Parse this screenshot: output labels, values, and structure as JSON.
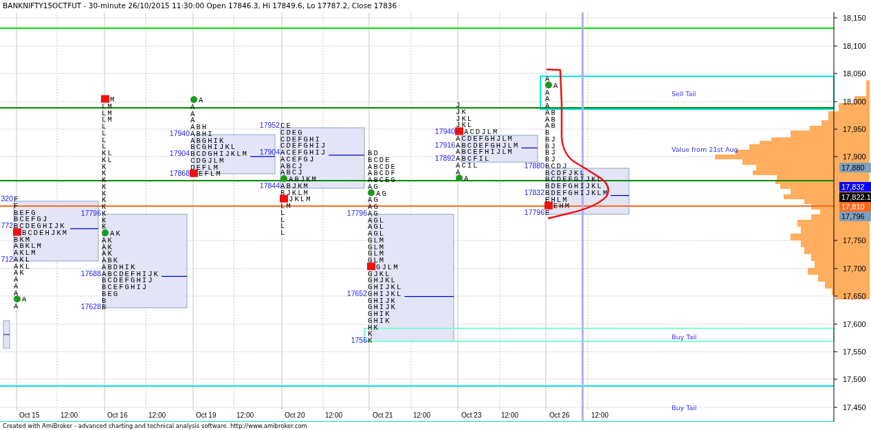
{
  "title": "BANKNIFTY15OCTFUT - 30-minute 26/10/2015 11:30:00 Open 17846.3, Hi 17849.6, Lo 17787.2, Close 17836",
  "days": [
    {
      "rows": [
        {
          "price": "320",
          "tpo": "F"
        },
        {
          "tpo": "F"
        },
        {
          "tpo": "BEFG"
        },
        {
          "tpo": "BCEFGJ"
        },
        {
          "price": "772",
          "tpo": "BCDEGHIJK"
        },
        {
          "tpo": "BCDEHJKM"
        },
        {
          "tpo": "BKM"
        },
        {
          "tpo": "ABKLM"
        },
        {
          "tpo": "AKLM"
        },
        {
          "price": "712",
          "tpo": "AKL"
        },
        {
          "tpo": "AKL"
        },
        {
          "tpo": "AK"
        },
        {
          "tpo": "A"
        },
        {
          "tpo": "A"
        },
        {
          "tpo": "A"
        },
        {
          "tpo": "A"
        },
        {
          "tpo": "A"
        }
      ]
    },
    {
      "rows": [
        {
          "tpo": "M"
        },
        {
          "tpo": "LM"
        },
        {
          "tpo": "LM"
        },
        {
          "tpo": "LM"
        },
        {
          "tpo": "L"
        },
        {
          "tpo": "L"
        },
        {
          "tpo": "L"
        },
        {
          "tpo": "L"
        },
        {
          "tpo": "KL"
        },
        {
          "tpo": "KL"
        },
        {
          "tpo": "K"
        },
        {
          "tpo": "K"
        },
        {
          "tpo": "K"
        },
        {
          "tpo": "K"
        },
        {
          "tpo": "K"
        },
        {
          "tpo": "K"
        },
        {
          "tpo": "K"
        },
        {
          "price": "17796",
          "tpo": "K"
        },
        {
          "tpo": "K"
        },
        {
          "tpo": "K"
        },
        {
          "tpo": "AK"
        },
        {
          "tpo": "AK"
        },
        {
          "tpo": "AK"
        },
        {
          "tpo": "AK"
        },
        {
          "tpo": "ABK"
        },
        {
          "tpo": "ABDHIK"
        },
        {
          "price": "17688",
          "tpo": "ABCDEFHIJK"
        },
        {
          "tpo": "BCDEFGHIJ"
        },
        {
          "tpo": "BCEFGHIJ"
        },
        {
          "tpo": "BEG"
        },
        {
          "tpo": "B"
        },
        {
          "price": "17628",
          "tpo": "B"
        }
      ]
    },
    {
      "rows": [
        {
          "tpo": "A"
        },
        {
          "tpo": "A"
        },
        {
          "tpo": "A"
        },
        {
          "tpo": "A"
        },
        {
          "tpo": "ABH"
        },
        {
          "price": "17940",
          "tpo": "ABHI"
        },
        {
          "tpo": "ABGHIK"
        },
        {
          "tpo": "BCGHIJKL"
        },
        {
          "price": "17904",
          "tpo": "BCDGHIJKLM"
        },
        {
          "tpo": "CDGJLM"
        },
        {
          "tpo": "DEFLM"
        },
        {
          "price": "17868",
          "tpo": "EFLM"
        }
      ]
    },
    {
      "rows": [
        {
          "price": "17952",
          "tpo": "CE"
        },
        {
          "tpo": "CDEG"
        },
        {
          "tpo": "CDEFGHI"
        },
        {
          "tpo": "CDEFGHIJ"
        },
        {
          "price": "17904",
          "tpo": "ACEFGHIJ"
        },
        {
          "tpo": "ACEFGJ"
        },
        {
          "tpo": "ABCJ"
        },
        {
          "tpo": "ABCJ"
        },
        {
          "tpo": "ABJKM"
        },
        {
          "price": "17844",
          "tpo": "ABJKM"
        },
        {
          "tpo": "BJKLM"
        },
        {
          "tpo": "JKLM"
        },
        {
          "tpo": "LM"
        },
        {
          "tpo": "L"
        },
        {
          "tpo": "L"
        },
        {
          "tpo": "L"
        },
        {
          "tpo": "L"
        }
      ]
    },
    {
      "rows": [
        {
          "tpo": "BD"
        },
        {
          "tpo": "BCDE"
        },
        {
          "tpo": "ABCDE"
        },
        {
          "tpo": "ABCDF"
        },
        {
          "tpo": "ABCEG"
        },
        {
          "tpo": "AG"
        },
        {
          "tpo": "AG"
        },
        {
          "tpo": "AG"
        },
        {
          "tpo": "AG"
        },
        {
          "price": "17796",
          "tpo": "AG"
        },
        {
          "tpo": "AGL"
        },
        {
          "tpo": "AGL"
        },
        {
          "tpo": "AGL"
        },
        {
          "tpo": "GLM"
        },
        {
          "tpo": "GLM"
        },
        {
          "tpo": "GLM"
        },
        {
          "tpo": "GLM"
        },
        {
          "tpo": "GJLM"
        },
        {
          "tpo": "GJKL"
        },
        {
          "tpo": "GHJKL"
        },
        {
          "tpo": "GHIJKL"
        },
        {
          "price": "17652",
          "tpo": "GHIJKL"
        },
        {
          "tpo": "GHIJK"
        },
        {
          "tpo": "GHIJK"
        },
        {
          "tpo": "GHIK"
        },
        {
          "tpo": "GHIK"
        },
        {
          "tpo": "HK"
        },
        {
          "tpo": "K"
        },
        {
          "price": "1756",
          "tpo": "K"
        }
      ]
    },
    {
      "rows": [
        {
          "tpo": "J"
        },
        {
          "tpo": "JK"
        },
        {
          "tpo": "JKL"
        },
        {
          "tpo": "JKL"
        },
        {
          "price": "17940",
          "tpo": "ACDJLM"
        },
        {
          "tpo": "ACDEFGHJLM"
        },
        {
          "price": "17916",
          "tpo": "ABCDEFGHJLM"
        },
        {
          "tpo": "ABCEFHIJLM"
        },
        {
          "price": "17892",
          "tpo": "ABCFIL"
        },
        {
          "tpo": "ACIL"
        },
        {
          "tpo": "A"
        },
        {
          "tpo": "A"
        }
      ]
    },
    {
      "rows": [
        {
          "tpo": "A"
        },
        {
          "tpo": "A"
        },
        {
          "tpo": "A"
        },
        {
          "tpo": "A"
        },
        {
          "tpo": "A"
        },
        {
          "tpo": "AB"
        },
        {
          "tpo": "AB"
        },
        {
          "tpo": "AB"
        },
        {
          "tpo": "B"
        },
        {
          "tpo": "BJ"
        },
        {
          "tpo": "BJ"
        },
        {
          "tpo": "BJ"
        },
        {
          "tpo": "BJ"
        },
        {
          "price": "17880",
          "tpo": "BCDJ"
        },
        {
          "tpo": "BCDFJKL"
        },
        {
          "tpo": "BCDEFGIJKL"
        },
        {
          "tpo": "BDEFGHIJKL"
        },
        {
          "price": "17832",
          "tpo": "BDEFGHIJKLM"
        },
        {
          "tpo": "EHLM"
        },
        {
          "tpo": "EHM"
        },
        {
          "price": "17796",
          "tpo": "E"
        }
      ]
    }
  ],
  "annotations": [
    "Sell Tail",
    "Value from 21st Aug",
    "Buy Tail",
    "Buy Tail"
  ],
  "y_axis_ticks": [
    "18,150",
    "18,100",
    "18,050",
    "18,000",
    "17,950",
    "17,900",
    "17,750",
    "17,700",
    "17,650",
    "17,600",
    "17,550",
    "17,500",
    "17,450"
  ],
  "price_markers": [
    {
      "text": "17,880",
      "color": "#7f9fbf"
    },
    {
      "text": "17,832",
      "color": "#0000ff"
    },
    {
      "text": "17,822.1",
      "color": "#000000"
    },
    {
      "text": "17,810",
      "color": "#ff6a1a"
    },
    {
      "text": "17,796",
      "color": "#7f9fbf"
    }
  ],
  "x_axis_labels": [
    "Oct 15",
    "12:00",
    "Oct 16",
    "12:00",
    "Oct 19",
    "12:00",
    "Oct 20",
    "12:00",
    "Oct 21",
    "12:00",
    "Oct 23",
    "12:00",
    "Oct 26",
    "12:00"
  ],
  "footer": "Created with AmiBroker - advanced charting and technical analysis software. http://www.amibroker.com"
}
